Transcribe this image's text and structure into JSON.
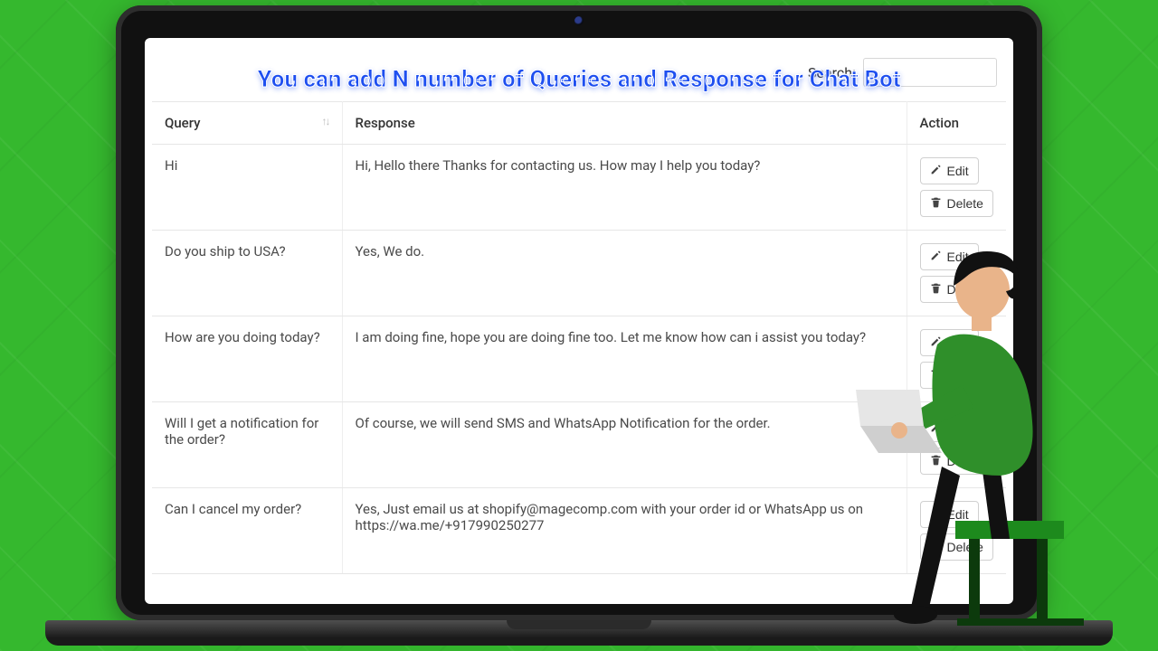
{
  "banner_title": "You can add N number of Queries and Response for Chat Bot",
  "search": {
    "label": "Search:",
    "value": ""
  },
  "columns": {
    "query": "Query",
    "response": "Response",
    "action": "Action"
  },
  "actions": {
    "edit": "Edit",
    "delete": "Delete"
  },
  "rows": [
    {
      "query": "Hi",
      "response": "Hi, Hello there Thanks for contacting us. How may I help you today?"
    },
    {
      "query": "Do you ship to USA?",
      "response": "Yes, We do."
    },
    {
      "query": "How are you doing today?",
      "response": "I am doing fine, hope you are doing fine too. Let me know how can i assist you today?"
    },
    {
      "query": "Will I get a notification for the order?",
      "response": "Of course, we will send SMS and WhatsApp Notification for the order."
    },
    {
      "query": "Can I cancel my order?",
      "response": "Yes, Just email us at shopify@magecomp.com with your order id or WhatsApp us on https://wa.me/+917990250277"
    }
  ]
}
